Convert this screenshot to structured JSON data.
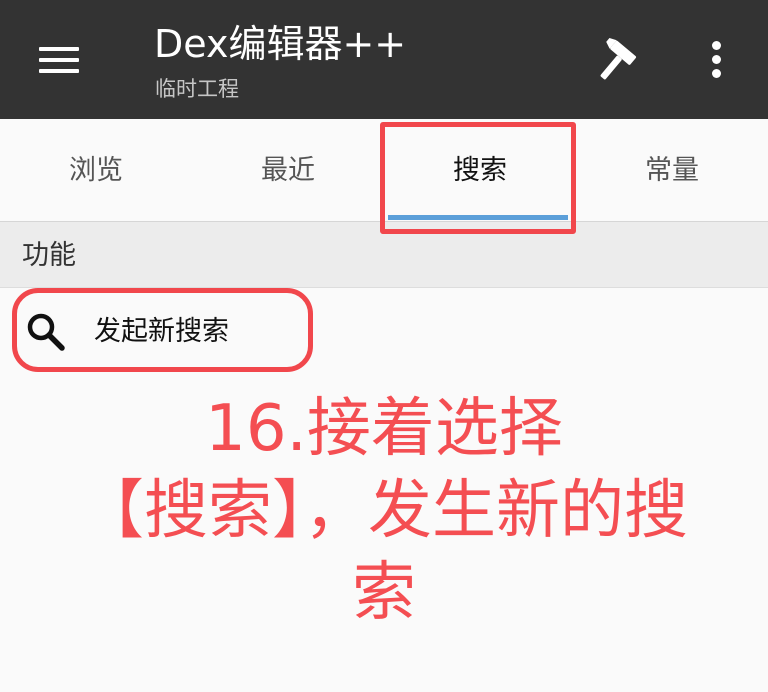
{
  "appbar": {
    "title": "Dex编辑器++",
    "subtitle": "临时工程",
    "icons": [
      "menu-icon",
      "hammer-icon",
      "more-vert-icon"
    ]
  },
  "tabs": [
    {
      "label": "浏览"
    },
    {
      "label": "最近"
    },
    {
      "label": "搜索",
      "selected": true
    },
    {
      "label": "常量"
    }
  ],
  "section": {
    "title": "功能"
  },
  "items": [
    {
      "label": "发起新搜索",
      "icon": "search-icon"
    }
  ],
  "annotation": {
    "line1": "16.接着选择",
    "line2": "【搜索】，发生新的搜",
    "line3": "索"
  },
  "colors": {
    "appbar": "#333333",
    "accent": "#5b9fd9",
    "annotation_red": "#f44e52"
  }
}
